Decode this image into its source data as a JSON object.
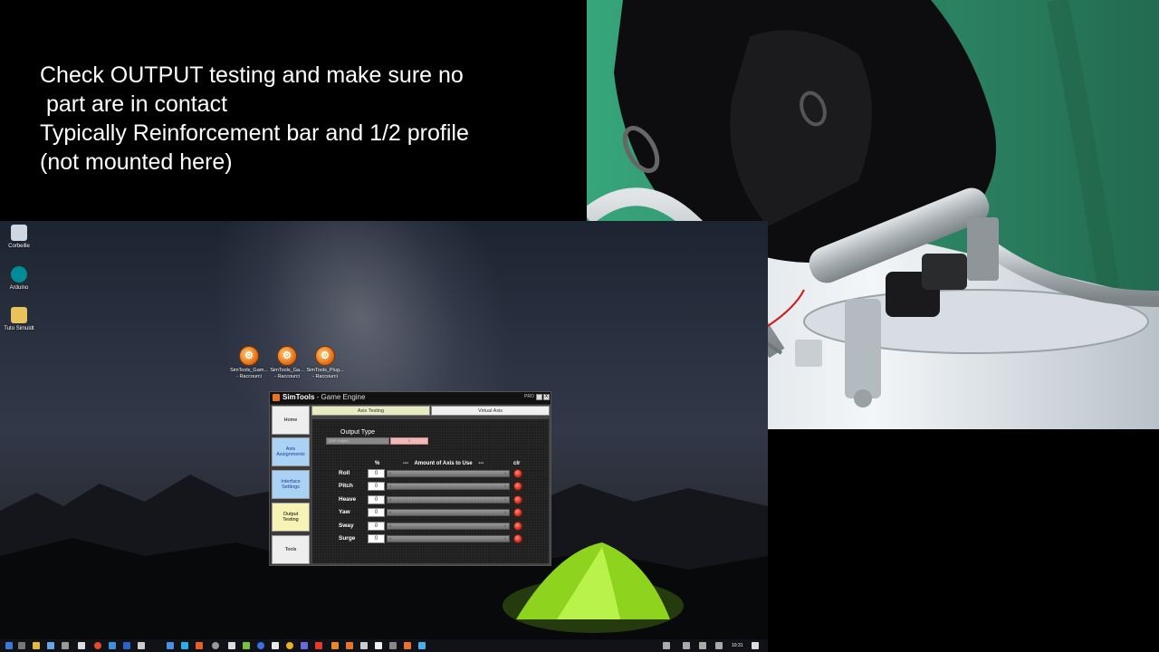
{
  "caption": {
    "lines": [
      "Check OUTPUT testing and make sure no",
      " part are in contact",
      "Typically Reinforcement bar and 1/2 profile",
      "(not mounted here)"
    ]
  },
  "desktop_icons": [
    {
      "label": "Corbeille",
      "icon": "recycle-bin-icon"
    },
    {
      "label": "Arduino",
      "icon": "arduino-icon"
    },
    {
      "label": "Tuto Simuldt",
      "icon": "folder-icon"
    }
  ],
  "simtools_shortcuts": [
    {
      "label": "SimTools_Gam...\n- Raccourci",
      "icon": "simtools-icon"
    },
    {
      "label": "SimTools_Ga...\n- Raccourci",
      "icon": "simtools-icon"
    },
    {
      "label": "SimTools_Plug...\n- Raccourci",
      "icon": "simtools-icon"
    }
  ],
  "simtools": {
    "title_app": "SimTools",
    "title_sep": " - ",
    "title_rest": "Game Engine",
    "pro_badge": "PRO",
    "close_glyph": "X",
    "nav": {
      "home": "Home",
      "axis_assignments": "Axis\nAssignments",
      "interface_settings": "Interface\nSettings",
      "output_testing": "Output\nTesting",
      "tools": "Tools"
    },
    "tabs": {
      "axis_testing": "Axis Testing",
      "virtual_axis": "Virtual Axis"
    },
    "output_type_label": "Output Type",
    "output_type_value": "DOF Output",
    "output_type_button": "2",
    "headers": {
      "percent": "%",
      "amount": "---    Amount of Axis to Use    ---",
      "clear": "clr"
    },
    "axes": [
      {
        "name": "Roll",
        "value": "0",
        "bar_min": "0",
        "bar_max": "0"
      },
      {
        "name": "Pitch",
        "value": "0",
        "bar_min": "0",
        "bar_max": "0"
      },
      {
        "name": "Heave",
        "value": "0",
        "bar_min": "0",
        "bar_max": "0"
      },
      {
        "name": "Yaw",
        "value": "0",
        "bar_min": "0",
        "bar_max": "0"
      },
      {
        "name": "Sway",
        "value": "0",
        "bar_min": "0",
        "bar_max": "0"
      },
      {
        "name": "Surge",
        "value": "0",
        "bar_min": "0",
        "bar_max": "0"
      }
    ]
  },
  "taskbar": {
    "clock": "10:31"
  },
  "colors": {
    "sim_accent": "#e8731a",
    "nav_blue": "#a9d2f5",
    "nav_active": "#f7f3b5",
    "tab_active": "#e9ecc2",
    "clear_red": "#d62a1a",
    "greenscreen": "#2f8a6a",
    "tent_green": "#9be32a"
  }
}
